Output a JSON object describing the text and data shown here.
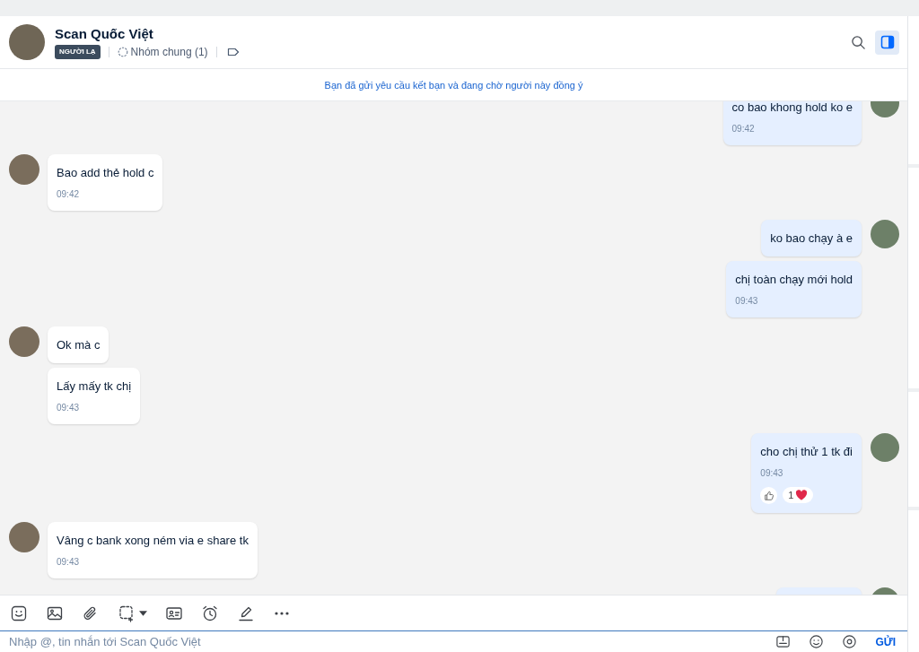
{
  "contact": {
    "name": "Scan Quốc Việt",
    "badge": "NGƯỜI LẠ",
    "common_groups": "Nhóm chung (1)"
  },
  "panel_toggle": {
    "selected": true
  },
  "notice": "Bạn đã gửi yêu cầu kết bạn và đang chờ người này đồng ý",
  "messages": [
    {
      "kind": "sent",
      "bubbles": [
        {
          "text": "co bao khong hold ko e",
          "time": "09:42"
        }
      ]
    },
    {
      "kind": "received",
      "bubbles": [
        {
          "text": "Bao add thẻ hold c",
          "time": "09:42"
        }
      ]
    },
    {
      "kind": "sent",
      "bubbles": [
        {
          "text": "ko bao chạy à e"
        },
        {
          "text": "chị toàn chạy mới hold",
          "time": "09:43"
        }
      ]
    },
    {
      "kind": "received",
      "bubbles": [
        {
          "text": "Ok mà c"
        },
        {
          "text": "Lấy mấy tk chị",
          "time": "09:43"
        }
      ]
    },
    {
      "kind": "sent",
      "bubbles": [
        {
          "text": "cho chị thử 1 tk đi",
          "time": "09:43",
          "like_button": true,
          "reaction_count": "1"
        }
      ]
    },
    {
      "kind": "received",
      "bubbles": [
        {
          "text": "Vâng c bank xong ném via e share tk",
          "time": "09:43"
        }
      ]
    },
    {
      "kind": "sent",
      "cut_off": true
    }
  ],
  "composer": {
    "placeholder": "Nhập @, tin nhắn tới Scan Quốc Việt",
    "send": "GỬI"
  }
}
